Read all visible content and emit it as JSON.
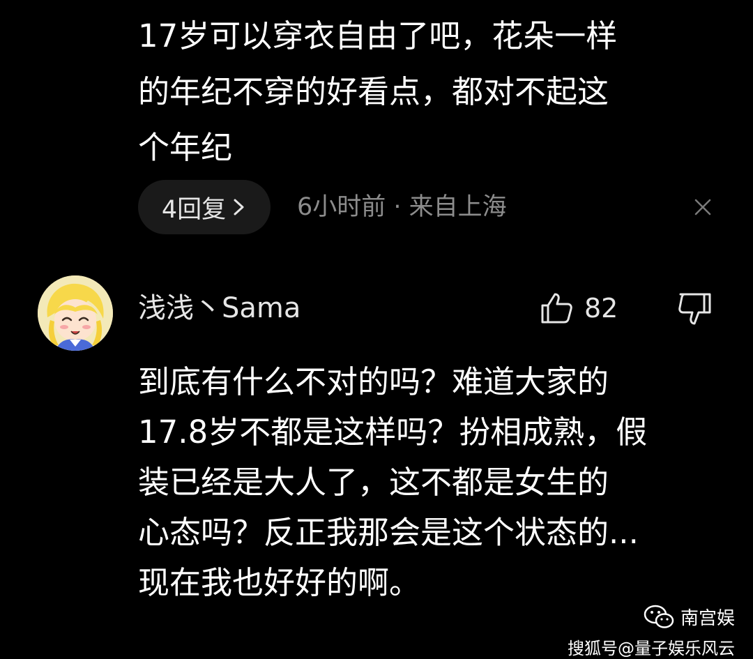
{
  "previous_comment": {
    "lines": [
      "17岁可以穿衣自由了吧，花朵一样",
      "的年纪不穿的好看点，都对不起这",
      "个年纪"
    ],
    "reply_button_label": "4回复",
    "meta": "6小时前 · 来自上海",
    "close_icon": "close-icon"
  },
  "comment": {
    "username": "浅浅丶Sama",
    "avatar": "anime-avatar",
    "like_count": "82",
    "like_icon": "thumbs-up-icon",
    "dislike_icon": "thumbs-down-icon",
    "body_lines": [
      "到底有什么不对的吗？难道大家的",
      "17.8岁不都是这样吗？扮相成熟，假",
      "装已经是大人了，这不都是女生的",
      "心态吗？反正我那会是这个状态的...",
      "现在我也好好的啊。"
    ]
  },
  "watermark": {
    "account_name": "南宫娱",
    "source": "搜狐号@量子娱乐风云",
    "logo_icon": "wechat-icon"
  },
  "colors": {
    "background": "#000000",
    "text_primary": "#ffffff",
    "text_secondary": "#8c8c8c",
    "pill_background": "#1a1a1a"
  }
}
